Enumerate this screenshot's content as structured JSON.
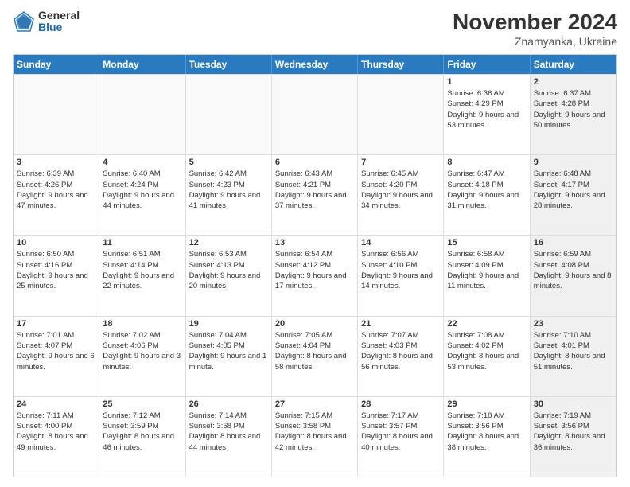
{
  "header": {
    "logo_general": "General",
    "logo_blue": "Blue",
    "month_title": "November 2024",
    "location": "Znamyanka, Ukraine"
  },
  "days_of_week": [
    "Sunday",
    "Monday",
    "Tuesday",
    "Wednesday",
    "Thursday",
    "Friday",
    "Saturday"
  ],
  "weeks": [
    [
      {
        "day": "",
        "info": "",
        "shaded": false,
        "empty": true
      },
      {
        "day": "",
        "info": "",
        "shaded": false,
        "empty": true
      },
      {
        "day": "",
        "info": "",
        "shaded": false,
        "empty": true
      },
      {
        "day": "",
        "info": "",
        "shaded": false,
        "empty": true
      },
      {
        "day": "",
        "info": "",
        "shaded": false,
        "empty": true
      },
      {
        "day": "1",
        "info": "Sunrise: 6:36 AM\nSunset: 4:29 PM\nDaylight: 9 hours and 53 minutes.",
        "shaded": false,
        "empty": false
      },
      {
        "day": "2",
        "info": "Sunrise: 6:37 AM\nSunset: 4:28 PM\nDaylight: 9 hours and 50 minutes.",
        "shaded": true,
        "empty": false
      }
    ],
    [
      {
        "day": "3",
        "info": "Sunrise: 6:39 AM\nSunset: 4:26 PM\nDaylight: 9 hours and 47 minutes.",
        "shaded": false,
        "empty": false
      },
      {
        "day": "4",
        "info": "Sunrise: 6:40 AM\nSunset: 4:24 PM\nDaylight: 9 hours and 44 minutes.",
        "shaded": false,
        "empty": false
      },
      {
        "day": "5",
        "info": "Sunrise: 6:42 AM\nSunset: 4:23 PM\nDaylight: 9 hours and 41 minutes.",
        "shaded": false,
        "empty": false
      },
      {
        "day": "6",
        "info": "Sunrise: 6:43 AM\nSunset: 4:21 PM\nDaylight: 9 hours and 37 minutes.",
        "shaded": false,
        "empty": false
      },
      {
        "day": "7",
        "info": "Sunrise: 6:45 AM\nSunset: 4:20 PM\nDaylight: 9 hours and 34 minutes.",
        "shaded": false,
        "empty": false
      },
      {
        "day": "8",
        "info": "Sunrise: 6:47 AM\nSunset: 4:18 PM\nDaylight: 9 hours and 31 minutes.",
        "shaded": false,
        "empty": false
      },
      {
        "day": "9",
        "info": "Sunrise: 6:48 AM\nSunset: 4:17 PM\nDaylight: 9 hours and 28 minutes.",
        "shaded": true,
        "empty": false
      }
    ],
    [
      {
        "day": "10",
        "info": "Sunrise: 6:50 AM\nSunset: 4:16 PM\nDaylight: 9 hours and 25 minutes.",
        "shaded": false,
        "empty": false
      },
      {
        "day": "11",
        "info": "Sunrise: 6:51 AM\nSunset: 4:14 PM\nDaylight: 9 hours and 22 minutes.",
        "shaded": false,
        "empty": false
      },
      {
        "day": "12",
        "info": "Sunrise: 6:53 AM\nSunset: 4:13 PM\nDaylight: 9 hours and 20 minutes.",
        "shaded": false,
        "empty": false
      },
      {
        "day": "13",
        "info": "Sunrise: 6:54 AM\nSunset: 4:12 PM\nDaylight: 9 hours and 17 minutes.",
        "shaded": false,
        "empty": false
      },
      {
        "day": "14",
        "info": "Sunrise: 6:56 AM\nSunset: 4:10 PM\nDaylight: 9 hours and 14 minutes.",
        "shaded": false,
        "empty": false
      },
      {
        "day": "15",
        "info": "Sunrise: 6:58 AM\nSunset: 4:09 PM\nDaylight: 9 hours and 11 minutes.",
        "shaded": false,
        "empty": false
      },
      {
        "day": "16",
        "info": "Sunrise: 6:59 AM\nSunset: 4:08 PM\nDaylight: 9 hours and 8 minutes.",
        "shaded": true,
        "empty": false
      }
    ],
    [
      {
        "day": "17",
        "info": "Sunrise: 7:01 AM\nSunset: 4:07 PM\nDaylight: 9 hours and 6 minutes.",
        "shaded": false,
        "empty": false
      },
      {
        "day": "18",
        "info": "Sunrise: 7:02 AM\nSunset: 4:06 PM\nDaylight: 9 hours and 3 minutes.",
        "shaded": false,
        "empty": false
      },
      {
        "day": "19",
        "info": "Sunrise: 7:04 AM\nSunset: 4:05 PM\nDaylight: 9 hours and 1 minute.",
        "shaded": false,
        "empty": false
      },
      {
        "day": "20",
        "info": "Sunrise: 7:05 AM\nSunset: 4:04 PM\nDaylight: 8 hours and 58 minutes.",
        "shaded": false,
        "empty": false
      },
      {
        "day": "21",
        "info": "Sunrise: 7:07 AM\nSunset: 4:03 PM\nDaylight: 8 hours and 56 minutes.",
        "shaded": false,
        "empty": false
      },
      {
        "day": "22",
        "info": "Sunrise: 7:08 AM\nSunset: 4:02 PM\nDaylight: 8 hours and 53 minutes.",
        "shaded": false,
        "empty": false
      },
      {
        "day": "23",
        "info": "Sunrise: 7:10 AM\nSunset: 4:01 PM\nDaylight: 8 hours and 51 minutes.",
        "shaded": true,
        "empty": false
      }
    ],
    [
      {
        "day": "24",
        "info": "Sunrise: 7:11 AM\nSunset: 4:00 PM\nDaylight: 8 hours and 49 minutes.",
        "shaded": false,
        "empty": false
      },
      {
        "day": "25",
        "info": "Sunrise: 7:12 AM\nSunset: 3:59 PM\nDaylight: 8 hours and 46 minutes.",
        "shaded": false,
        "empty": false
      },
      {
        "day": "26",
        "info": "Sunrise: 7:14 AM\nSunset: 3:58 PM\nDaylight: 8 hours and 44 minutes.",
        "shaded": false,
        "empty": false
      },
      {
        "day": "27",
        "info": "Sunrise: 7:15 AM\nSunset: 3:58 PM\nDaylight: 8 hours and 42 minutes.",
        "shaded": false,
        "empty": false
      },
      {
        "day": "28",
        "info": "Sunrise: 7:17 AM\nSunset: 3:57 PM\nDaylight: 8 hours and 40 minutes.",
        "shaded": false,
        "empty": false
      },
      {
        "day": "29",
        "info": "Sunrise: 7:18 AM\nSunset: 3:56 PM\nDaylight: 8 hours and 38 minutes.",
        "shaded": false,
        "empty": false
      },
      {
        "day": "30",
        "info": "Sunrise: 7:19 AM\nSunset: 3:56 PM\nDaylight: 8 hours and 36 minutes.",
        "shaded": true,
        "empty": false
      }
    ]
  ]
}
